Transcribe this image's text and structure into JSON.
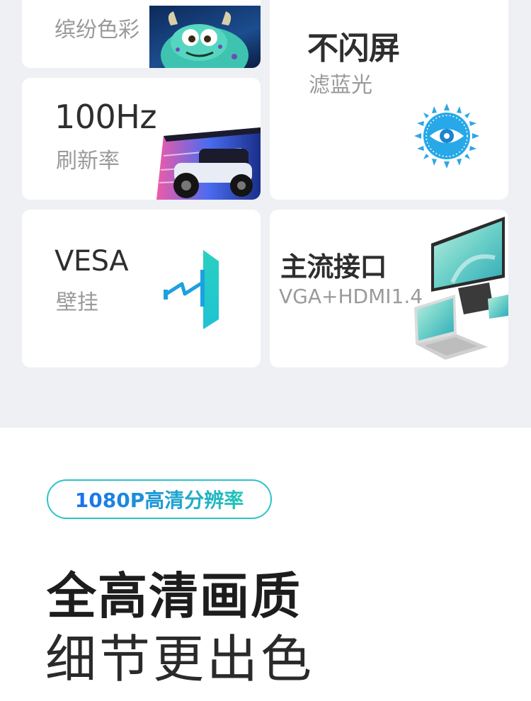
{
  "cards": {
    "color": {
      "sub": "缤纷色彩"
    },
    "flicker": {
      "title": "不闪屏",
      "sub": "滤蓝光"
    },
    "refresh": {
      "title": "100Hz",
      "sub": "刷新率"
    },
    "vesa": {
      "title": "VESA",
      "sub": "壁挂"
    },
    "ports": {
      "title": "主流接口",
      "sub": "VGA+HDMI1.4"
    }
  },
  "section": {
    "badge": "1080P高清分辨率",
    "headline": "全高清画质",
    "subline": "细节更出色"
  },
  "colors": {
    "accent_blue": "#1d76e3",
    "accent_teal": "#21c6b6",
    "bg_gray": "#eef0f4"
  }
}
